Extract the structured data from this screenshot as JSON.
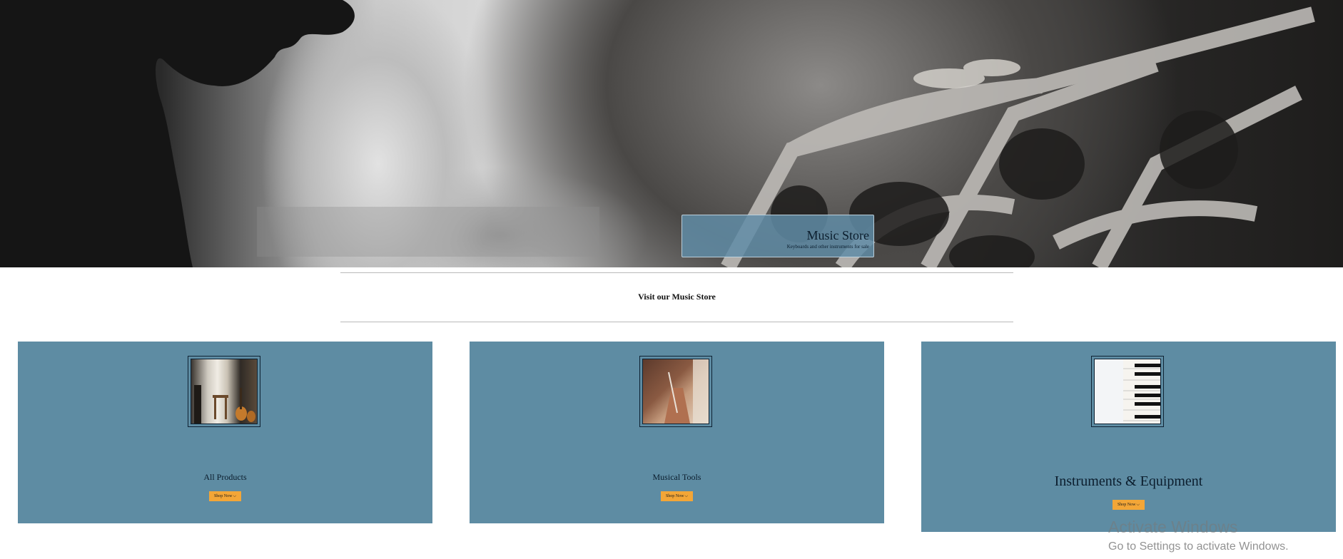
{
  "hero": {
    "title": "Music Store",
    "subtitle": "Keyboards and other instruments for sale"
  },
  "intro": {
    "heading": "Visit our Music Store"
  },
  "cards": [
    {
      "title": "All Products",
      "button": "Shop Now",
      "icon": "chevron-down-icon"
    },
    {
      "title": "Musical Tools",
      "button": "Shop Now",
      "icon": "chevron-down-icon"
    },
    {
      "title": "Instruments & Equipment",
      "button": "Shop Now",
      "icon": "chevron-down-icon"
    }
  ],
  "watermark": {
    "line1": "Activate Windows",
    "line2": "Go to Settings to activate Windows."
  },
  "colors": {
    "card_bg": "#5e8ca3",
    "button_bg": "#f3a637",
    "caption_bg": "#608ca6"
  }
}
